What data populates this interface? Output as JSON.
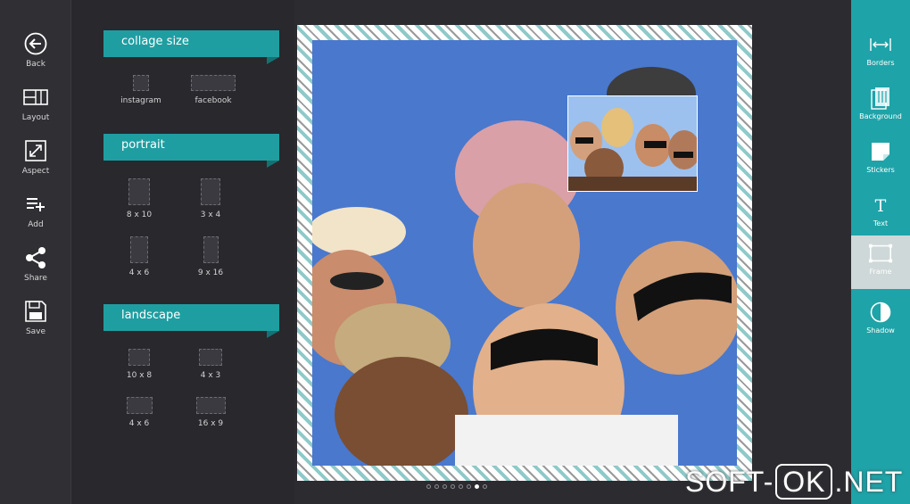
{
  "left_toolbar": [
    {
      "label": "Back",
      "icon": "back-arrow-icon"
    },
    {
      "label": "Layout",
      "icon": "layout-icon"
    },
    {
      "label": "Aspect",
      "icon": "aspect-icon"
    },
    {
      "label": "Add",
      "icon": "add-list-icon"
    },
    {
      "label": "Share",
      "icon": "share-icon"
    },
    {
      "label": "Save",
      "icon": "save-icon"
    }
  ],
  "panel": {
    "collage_size": {
      "title": "collage size",
      "options": [
        {
          "label": "instagram"
        },
        {
          "label": "facebook"
        }
      ]
    },
    "portrait": {
      "title": "portrait",
      "options": [
        {
          "label": "8 x 10"
        },
        {
          "label": "3 x 4"
        },
        {
          "label": "4 x 6"
        },
        {
          "label": "9 x 16"
        }
      ]
    },
    "landscape": {
      "title": "landscape",
      "options": [
        {
          "label": "10 x 8"
        },
        {
          "label": "4 x 3"
        },
        {
          "label": "4 x 6"
        },
        {
          "label": "16 x 9"
        }
      ]
    }
  },
  "pager": {
    "total": 8,
    "active_index": 6
  },
  "right_toolbar": [
    {
      "label": "Borders",
      "icon": "borders-icon"
    },
    {
      "label": "Background",
      "icon": "background-icon"
    },
    {
      "label": "Stickers",
      "icon": "stickers-icon"
    },
    {
      "label": "Text",
      "icon": "text-icon"
    },
    {
      "label": "Frame",
      "icon": "frame-icon",
      "active": true
    },
    {
      "label": "Shadow",
      "icon": "shadow-icon"
    }
  ],
  "watermark": {
    "left": "SOFT-",
    "boxed": "OK",
    "right": ".NET"
  },
  "colors": {
    "accent": "#1ea3a8",
    "panel_head": "#1f9ea1",
    "background": "#2b2b30"
  }
}
